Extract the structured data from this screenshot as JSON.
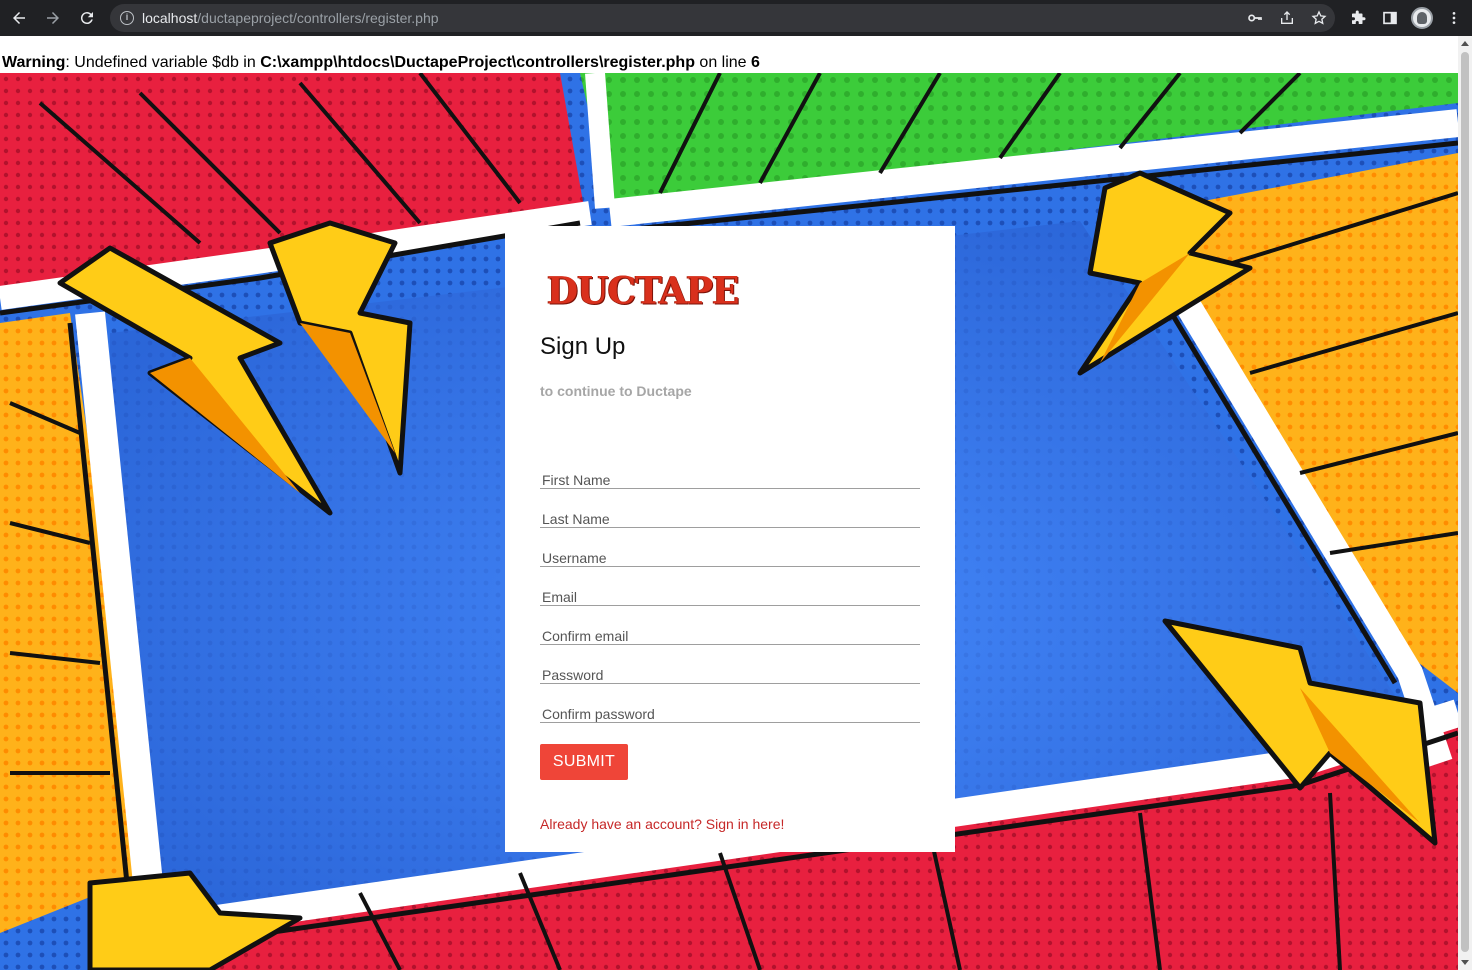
{
  "browser": {
    "url_host": "localhost",
    "url_path": "/ductapeproject/controllers/register.php"
  },
  "warning": {
    "label": "Warning",
    "message_pre": ": Undefined variable $db in ",
    "file_path": "C:\\xampp\\htdocs\\DuctapeProject\\controllers\\register.php",
    "message_mid": " on line ",
    "line_number": "6"
  },
  "card": {
    "logo_text": "DUCTAPE",
    "title": "Sign Up",
    "subtitle": "to continue to Ductape",
    "fields": [
      {
        "placeholder": "First Name",
        "value": ""
      },
      {
        "placeholder": "Last Name",
        "value": ""
      },
      {
        "placeholder": "Username",
        "value": ""
      },
      {
        "placeholder": "Email",
        "value": ""
      },
      {
        "placeholder": "Confirm email",
        "value": ""
      },
      {
        "placeholder": "Password",
        "value": ""
      },
      {
        "placeholder": "Confirm password",
        "value": ""
      }
    ],
    "submit_label": "SUBMIT",
    "signin_link": "Already have an account? Sign in here!"
  },
  "colors": {
    "accent": "#ef4538",
    "link": "#c62828",
    "logo": "#d9301c"
  },
  "icons": [
    "back-icon",
    "forward-icon",
    "reload-icon",
    "info-icon",
    "key-icon",
    "share-icon",
    "star-icon",
    "extensions-icon",
    "sidepanel-icon",
    "profile-avatar",
    "menu-icon"
  ]
}
